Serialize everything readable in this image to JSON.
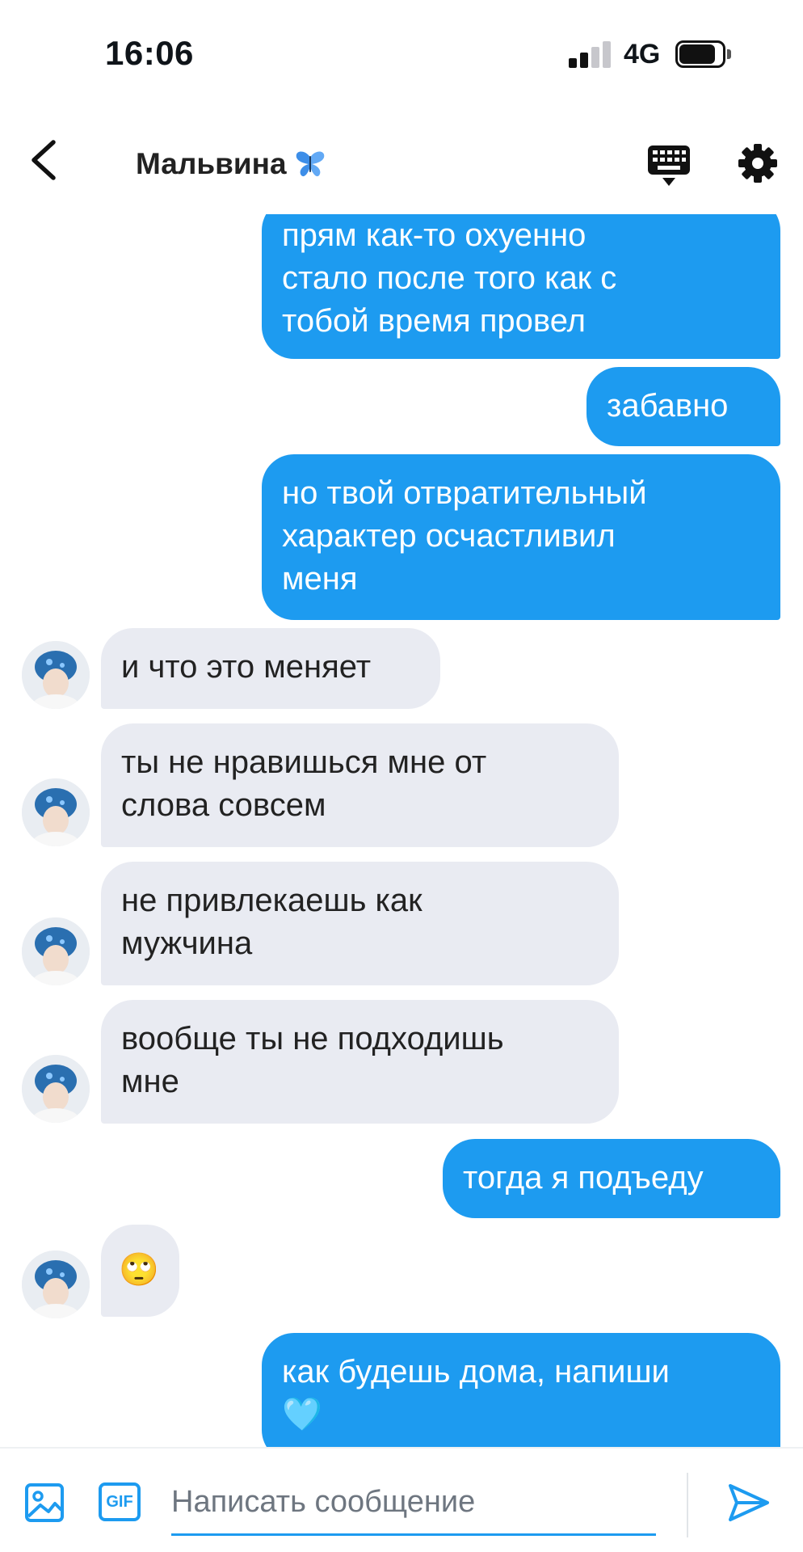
{
  "status_bar": {
    "time": "16:06",
    "network": "4G",
    "signal_bars": 2,
    "battery_level": 0.85
  },
  "header": {
    "title": "Мальвина",
    "title_emoji": "butterfly-icon",
    "icons": [
      "back-arrow-icon",
      "keyboard-icon",
      "gear-icon"
    ]
  },
  "messages": [
    {
      "direction": "outgoing",
      "text": "прям как-то охуенно\nстало после того как с\nтобой время провел"
    },
    {
      "direction": "outgoing",
      "text": "забавно"
    },
    {
      "direction": "outgoing",
      "text": "но твой отвратительный\nхарактер осчастливил\nменя"
    },
    {
      "direction": "incoming",
      "text": "и что это меняет"
    },
    {
      "direction": "incoming",
      "text": "ты не нравишься мне от\nслова совсем"
    },
    {
      "direction": "incoming",
      "text": "не привлекаешь как\nмужчина"
    },
    {
      "direction": "incoming",
      "text": "вообще ты не подходишь\nмне"
    },
    {
      "direction": "outgoing",
      "text": "тогда я подъеду"
    },
    {
      "direction": "incoming",
      "text": "🙄"
    },
    {
      "direction": "outgoing",
      "text": "как будешь дома, напиши\n🩵"
    }
  ],
  "composer": {
    "placeholder": "Написать сообщение",
    "gif_label": "GIF",
    "icons": [
      "image-icon",
      "send-icon"
    ]
  },
  "colors": {
    "accent": "#1d9bf0",
    "incoming_bubble": "#e9ebf2",
    "background": "#ffffff"
  }
}
